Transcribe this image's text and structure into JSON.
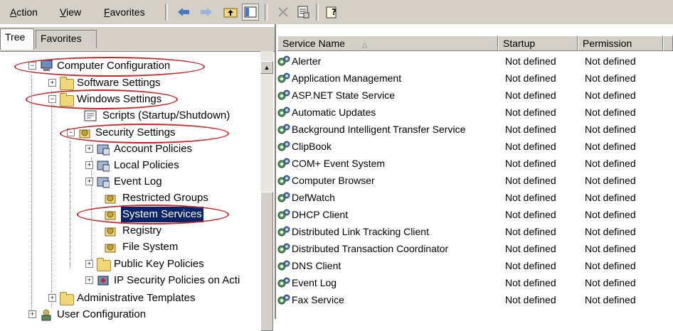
{
  "menu": {
    "action": "Action",
    "view": "View",
    "favorites": "Favorites"
  },
  "toolbar": {
    "icons": [
      "back-arrow-icon",
      "forward-arrow-icon",
      "up-folder-icon",
      "show-hide-tree-icon",
      "delete-icon",
      "properties-icon",
      "help-icon"
    ]
  },
  "tabs": {
    "tree": "Tree",
    "favorites": "Favorites"
  },
  "tree": {
    "computer_configuration": "Computer Configuration",
    "software_settings": "Software Settings",
    "windows_settings": "Windows Settings",
    "scripts": "Scripts (Startup/Shutdown)",
    "security_settings": "Security Settings",
    "account_policies": "Account Policies",
    "local_policies": "Local Policies",
    "event_log": "Event Log",
    "restricted_groups": "Restricted Groups",
    "system_services": "System Services",
    "registry": "Registry",
    "file_system": "File System",
    "public_key_policies": "Public Key Policies",
    "ip_security": "IP Security Policies on Acti",
    "administrative_templates": "Administrative Templates",
    "user_configuration": "User Configuration"
  },
  "columns": {
    "service_name": "Service Name",
    "startup": "Startup",
    "permission": "Permission"
  },
  "services": [
    {
      "name": "Alerter",
      "startup": "Not defined",
      "permission": "Not defined"
    },
    {
      "name": "Application Management",
      "startup": "Not defined",
      "permission": "Not defined"
    },
    {
      "name": "ASP.NET State Service",
      "startup": "Not defined",
      "permission": "Not defined"
    },
    {
      "name": "Automatic Updates",
      "startup": "Not defined",
      "permission": "Not defined"
    },
    {
      "name": "Background Intelligent Transfer Service",
      "startup": "Not defined",
      "permission": "Not defined"
    },
    {
      "name": "ClipBook",
      "startup": "Not defined",
      "permission": "Not defined"
    },
    {
      "name": "COM+ Event System",
      "startup": "Not defined",
      "permission": "Not defined"
    },
    {
      "name": "Computer Browser",
      "startup": "Not defined",
      "permission": "Not defined"
    },
    {
      "name": "DefWatch",
      "startup": "Not defined",
      "permission": "Not defined"
    },
    {
      "name": "DHCP Client",
      "startup": "Not defined",
      "permission": "Not defined"
    },
    {
      "name": "Distributed Link Tracking Client",
      "startup": "Not defined",
      "permission": "Not defined"
    },
    {
      "name": "Distributed Transaction Coordinator",
      "startup": "Not defined",
      "permission": "Not defined"
    },
    {
      "name": "DNS Client",
      "startup": "Not defined",
      "permission": "Not defined"
    },
    {
      "name": "Event Log",
      "startup": "Not defined",
      "permission": "Not defined"
    },
    {
      "name": "Fax Service",
      "startup": "Not defined",
      "permission": "Not defined"
    }
  ],
  "colors": {
    "selection": "#0a246a",
    "annotation": "#c62828",
    "folder": "#f0d77a",
    "chrome": "#d4d0c8"
  }
}
